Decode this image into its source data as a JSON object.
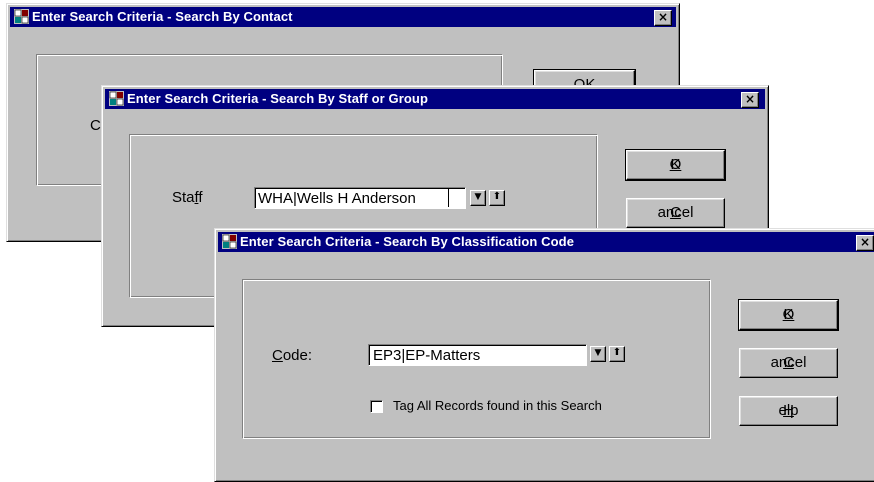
{
  "colors": {
    "face": "#c0c0c0",
    "title": "#000080",
    "desktop": "#ffffff"
  },
  "windows": {
    "contact": {
      "title": "Enter Search Criteria - Search By Contact",
      "icon": "app-window-icon",
      "close": "×",
      "partial_label": "C",
      "ok_button": "OK"
    },
    "staff": {
      "title": "Enter Search Criteria - Search By Staff or Group",
      "icon": "app-window-icon",
      "close": "×",
      "field_label_pre": "Sta",
      "field_label_mn": "f",
      "field_label_post": "f",
      "field_value": "WHA|Wells H Anderson",
      "ok_mn": "O",
      "ok_rest": "K",
      "cancel_mn": "C",
      "cancel_rest": "ancel"
    },
    "classification": {
      "title": "Enter Search Criteria - Search By Classification Code",
      "icon": "app-window-icon",
      "close": "×",
      "field_label_mn": "C",
      "field_label_rest": "ode:",
      "field_value": "EP3|EP-Matters",
      "checkbox_label": "Tag All Records found in this Search",
      "checkbox_checked": false,
      "ok_mn": "O",
      "ok_rest": "K",
      "cancel_mn": "C",
      "cancel_rest": "ancel",
      "help_mn": "H",
      "help_rest": "elp"
    }
  },
  "glyphs": {
    "dropdown": "▼",
    "lookup": "⬆"
  }
}
